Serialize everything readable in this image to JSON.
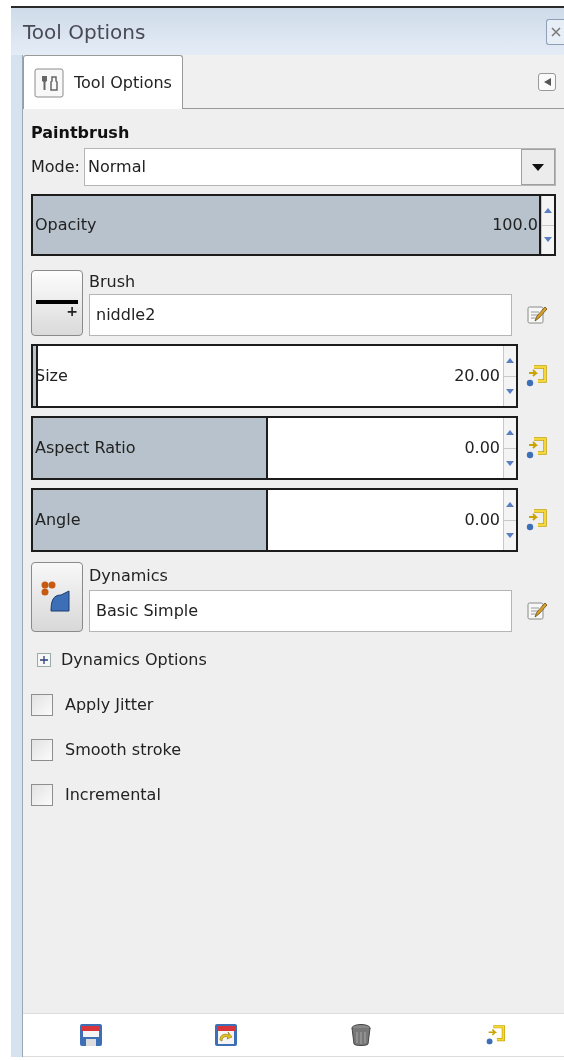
{
  "window": {
    "title": "Tool Options"
  },
  "tabs": [
    {
      "label": "Tool Options",
      "selected": true
    }
  ],
  "tool": {
    "name": "Paintbrush",
    "mode_label": "Mode:",
    "mode_value": "Normal"
  },
  "opacity": {
    "label": "Opacity",
    "value": "100.0",
    "level": 1
  },
  "brush": {
    "label": "Brush",
    "value": "niddle2",
    "preview_mark": "+"
  },
  "brush_sliders": [
    {
      "label": "Size",
      "value": "20.00",
      "level": 0.01
    },
    {
      "label": "Aspect Ratio",
      "value": "0.00",
      "level": 0.5
    },
    {
      "label": "Angle",
      "value": "0.00",
      "level": 0.5
    }
  ],
  "dynamics": {
    "label": "Dynamics",
    "value": "Basic Simple"
  },
  "dynamics_options": {
    "label": "Dynamics Options",
    "expanded": false
  },
  "checkboxes": [
    {
      "label": "Apply Jitter",
      "checked": false
    },
    {
      "label": "Smooth stroke",
      "checked": false
    },
    {
      "label": "Incremental",
      "checked": false
    }
  ]
}
